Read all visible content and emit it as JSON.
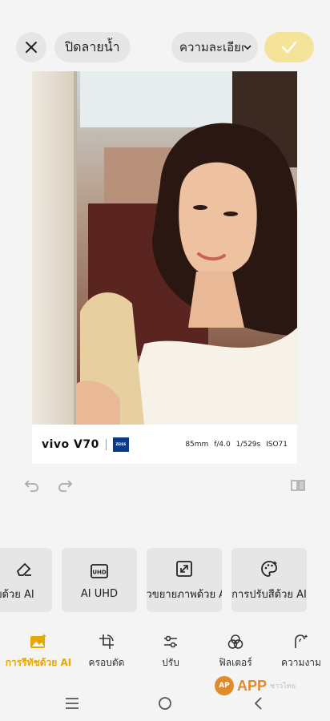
{
  "header": {
    "watermark_toggle_label": "ปิดลายน้ำ",
    "detail_label": "ความละเอียด",
    "icons": {
      "close": "close-icon",
      "detail": "chevron-down-icon",
      "confirm": "checkmark-icon"
    },
    "accent_color": "#f6e39a"
  },
  "watermark": {
    "brand": "vivo V70",
    "partner_logo": "ZEISS",
    "exif": [
      "85mm",
      "f/4.0",
      "1/529s",
      "ISO71"
    ]
  },
  "history": {
    "icons": {
      "undo": "undo-icon",
      "redo": "redo-icon",
      "compare": "compare-icon"
    }
  },
  "tools": [
    {
      "label": "ลบด้วย AI",
      "icon": "eraser-icon"
    },
    {
      "label": "AI UHD",
      "icon": "uhd-icon"
    },
    {
      "label": "ตัวขยายภาพด้วย AI",
      "icon": "expand-icon"
    },
    {
      "label": "การปรับสีด้วย AI",
      "icon": "palette-icon"
    }
  ],
  "tabs": [
    {
      "label": "การรีทัชด้วย AI",
      "icon": "ai-image-icon",
      "active": true,
      "active_color": "#e6a800"
    },
    {
      "label": "ครอบตัด",
      "icon": "crop-rotate-icon",
      "active": false
    },
    {
      "label": "ปรับ",
      "icon": "sliders-icon",
      "active": false
    },
    {
      "label": "ฟิลเตอร์",
      "icon": "filter-icon",
      "active": false
    },
    {
      "label": "ความงาม",
      "icon": "beauty-icon",
      "active": false
    }
  ],
  "system_nav": {
    "icons": [
      "menu-icon",
      "home-icon",
      "back-icon"
    ]
  },
  "site_watermark": {
    "badge": "AP",
    "text": "APP",
    "suffix": "ชาวไทย"
  }
}
